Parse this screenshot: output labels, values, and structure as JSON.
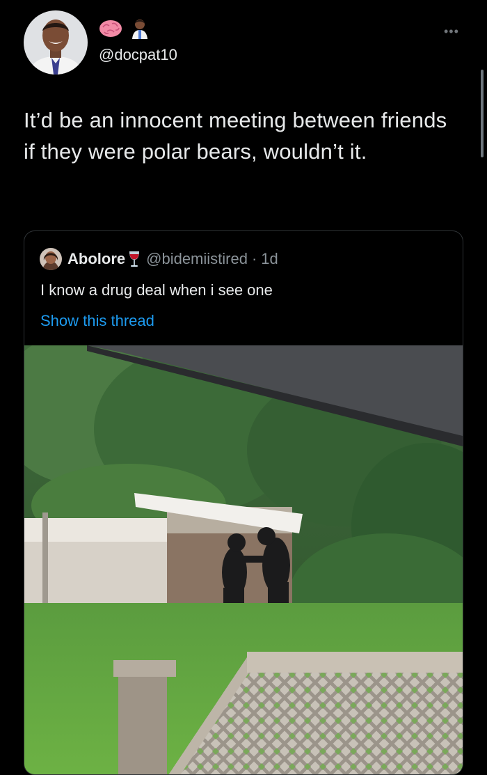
{
  "tweet": {
    "avatar_icon": "profile-photo-man-in-suit",
    "emojis": [
      "brain-icon",
      "health-worker-icon"
    ],
    "handle": "@docpat10",
    "more_icon": "more-horizontal-icon",
    "text": "It’d be an innocent meeting between friends if they were polar bears, wouldn’t it."
  },
  "quote": {
    "avatar_icon": "profile-photo-woman",
    "name": "Abolore",
    "name_emoji": "wine-glass-icon",
    "handle": "@bidemiistired",
    "separator": "·",
    "time": "1d",
    "text": "I know a drug deal when i see one",
    "show_thread": "Show this thread",
    "image": "photo-two-black-bears-standing-in-backyard"
  },
  "colors": {
    "background": "#000000",
    "text": "#e7e9ea",
    "secondary_text": "#8b9399",
    "link": "#1d9bf0",
    "border": "#2f3336"
  }
}
